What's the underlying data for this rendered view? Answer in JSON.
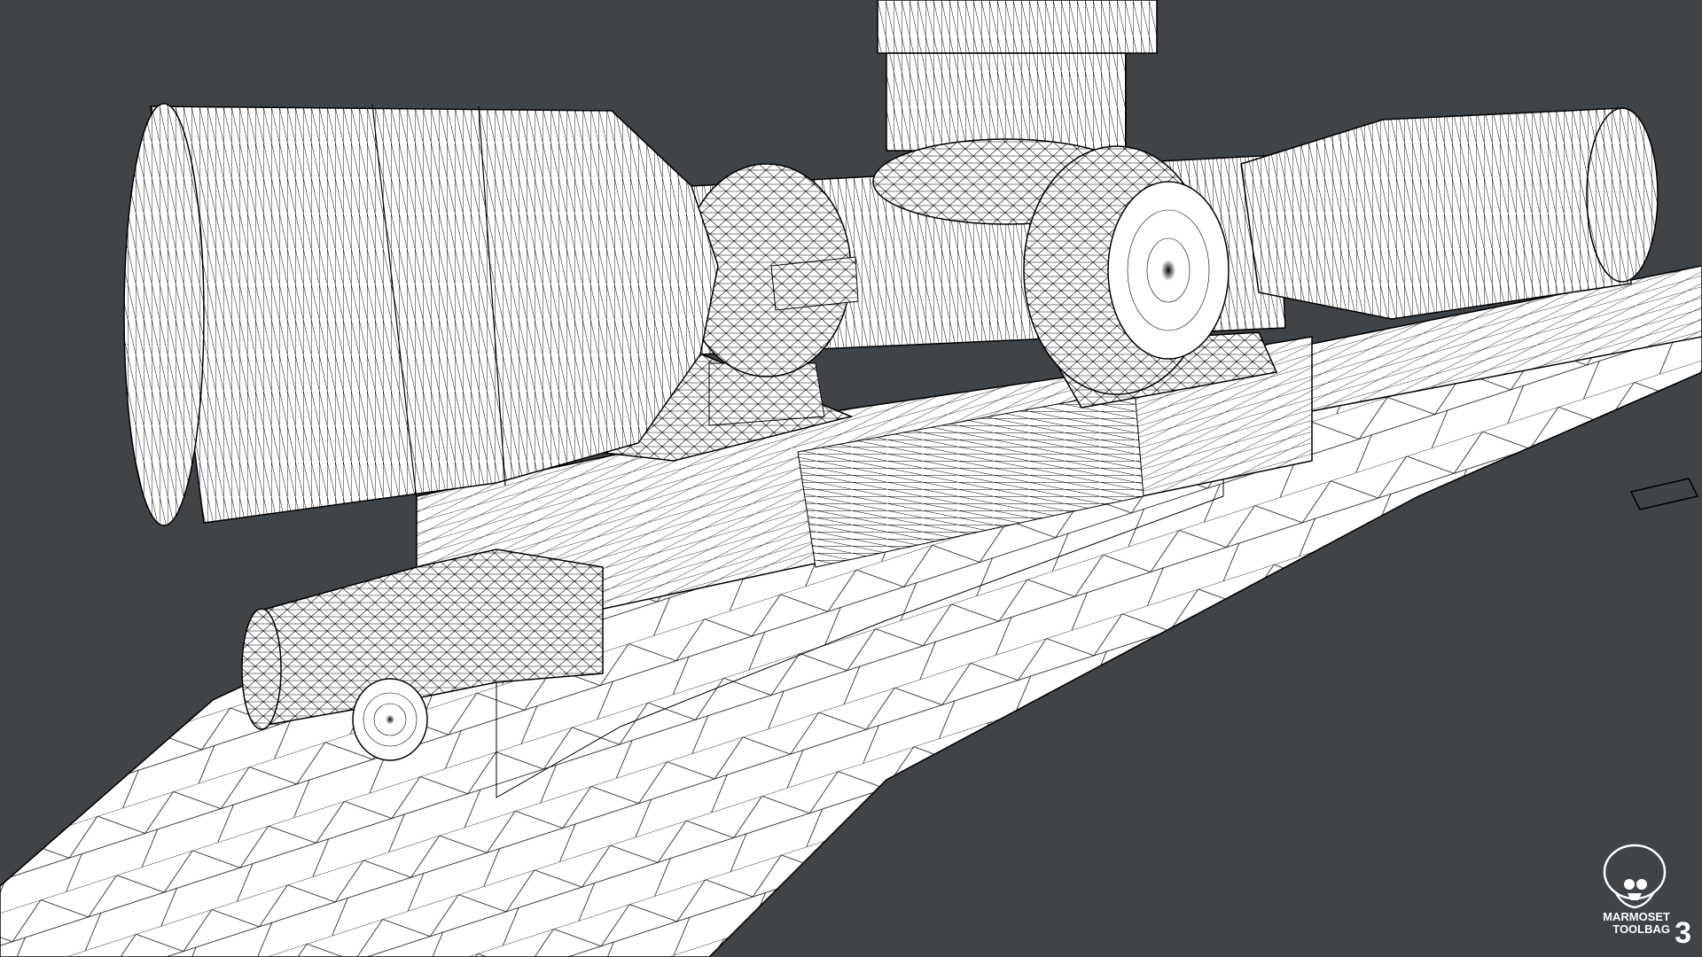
{
  "scene": {
    "background_color": "#3f4449",
    "fill_color": "#ffffff",
    "wire_color": "#000000",
    "subject": "wireframe-rifle-with-scope"
  },
  "watermark": {
    "line1": "MARMOSET",
    "line2": "TOOLBAG",
    "number": "3",
    "icon": "marmoset-skull-icon"
  }
}
